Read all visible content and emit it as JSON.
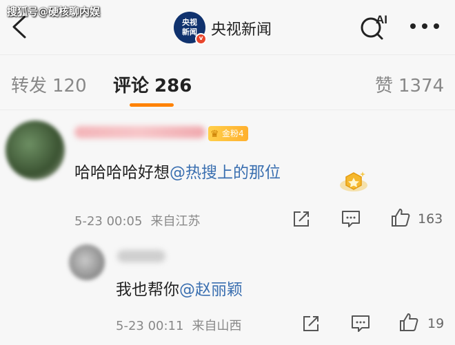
{
  "watermark": "搜狐号@硬核聊内娱",
  "header": {
    "logo_text_top": "央视",
    "logo_text_bottom": "新闻",
    "verified_mark": "v",
    "title": "央视新闻",
    "ai_label": "AI"
  },
  "tabs": [
    {
      "label": "转发",
      "count": "120",
      "active": false
    },
    {
      "label": "评论",
      "count": "286",
      "active": true
    },
    {
      "label": "赞",
      "count": "1374",
      "active": false
    }
  ],
  "comments": [
    {
      "fan_badge": "金粉4",
      "text_prefix": "哈哈哈哈好想",
      "mention": "@热搜上的那位",
      "time": "5-23 00:05",
      "location": "来自江苏",
      "likes": "163"
    },
    {
      "text_prefix": "我也帮你",
      "mention": "@赵丽颖",
      "time": "5-23 00:11",
      "location": "来自山西",
      "likes": "19"
    }
  ],
  "colors": {
    "accent": "#ff8200",
    "mention": "#3a6fb0",
    "logo_bg": "#10326e",
    "verified": "#e8452c"
  },
  "icons": [
    "back-arrow-icon",
    "ai-search-icon",
    "more-icon",
    "share-icon",
    "comment-icon",
    "thumbs-up-icon",
    "medal-icon",
    "crown-icon"
  ]
}
